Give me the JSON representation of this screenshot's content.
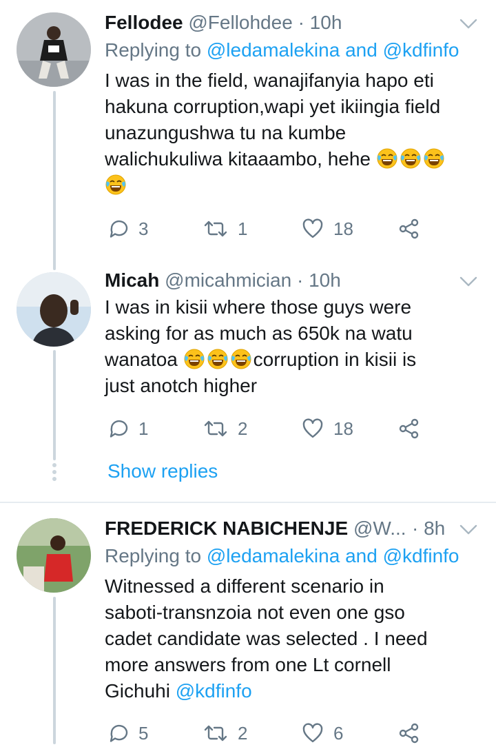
{
  "tweets": [
    {
      "name": "Fellodee",
      "handle": "@Fellohdee",
      "dot": "·",
      "time": "10h",
      "replying_prefix": "Replying to",
      "replying_user1": "@ledamalekina",
      "replying_and": "and",
      "replying_user2": "@kdfinfo",
      "text_lines": [
        "I was in the field, wanajifanyia hapo eti",
        "hakuna corruption,wapi yet ikiingia field",
        "unazungushwa tu na kumbe",
        "walichukuliwa kitaaambo, hehe"
      ],
      "reply_count": "3",
      "retweet_count": "1",
      "like_count": "18"
    },
    {
      "name": "Micah",
      "handle": "@micahmician",
      "dot": "·",
      "time": "10h",
      "text_lines": [
        "I was in kisii where those guys were",
        "asking for as much as 650k na watu",
        "wanatoa",
        "corruption in kisii is",
        "just anotch higher"
      ],
      "reply_count": "1",
      "retweet_count": "2",
      "like_count": "18"
    },
    {
      "name": "FREDERICK NABICHENJE",
      "handle": "@W...",
      "dot": "·",
      "time": "8h",
      "replying_prefix": "Replying to",
      "replying_user1": "@ledamalekina",
      "replying_and": "and",
      "replying_user2": "@kdfinfo",
      "text_lines": [
        "Witnessed a different scenario in",
        "saboti-transnzoia not even one gso",
        "cadet candidate was selected . I need",
        "more answers from one Lt cornell",
        "Gichuhi"
      ],
      "mention": "@kdfinfo",
      "reply_count": "5",
      "retweet_count": "2",
      "like_count": "6"
    }
  ],
  "show_replies": "Show replies",
  "icons": {
    "reply": "reply-icon",
    "retweet": "retweet-icon",
    "like": "heart-icon",
    "share": "share-icon",
    "caret": "chevron-down-icon",
    "emoji": "face-with-tears-of-joy-emoji"
  },
  "colors": {
    "accent": "#1da1f2",
    "secondary_text": "#657786",
    "thread_line": "#ccd6dd",
    "emoji_face": "#fcc21b"
  }
}
